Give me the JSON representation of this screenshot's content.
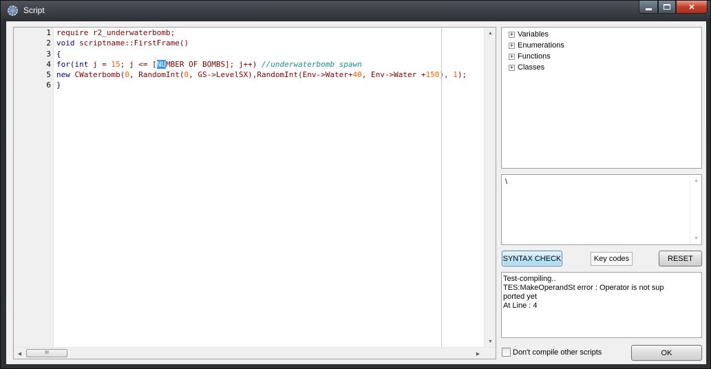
{
  "window": {
    "title": "Script"
  },
  "editor": {
    "line_numbers": [
      "1",
      "2",
      "3",
      "4",
      "5",
      "6"
    ],
    "lines": [
      [
        {
          "t": "require r2_underwaterbomb;",
          "c": "tx"
        }
      ],
      [
        {
          "t": "void ",
          "c": "kw"
        },
        {
          "t": "scriptname::FirstFrame()",
          "c": "tx"
        }
      ],
      [
        {
          "t": "{",
          "c": "kw"
        }
      ],
      [
        {
          "t": "for(int",
          "c": "kw"
        },
        {
          "t": " j = ",
          "c": "tx"
        },
        {
          "t": "15",
          "c": "num"
        },
        {
          "t": "; j <= [",
          "c": "tx"
        },
        {
          "t": "NU",
          "c": "sel"
        },
        {
          "t": "MBER OF BOMBS]; j++) ",
          "c": "tx"
        },
        {
          "t": "//underwaterbomb spawn",
          "c": "cm"
        }
      ],
      [
        {
          "t": "new",
          "c": "kw"
        },
        {
          "t": " CWaterbomb(",
          "c": "tx"
        },
        {
          "t": "0",
          "c": "num"
        },
        {
          "t": ", RandomInt(",
          "c": "tx"
        },
        {
          "t": "0",
          "c": "num"
        },
        {
          "t": ", GS->LevelSX),RandomInt(Env->Water+",
          "c": "tx"
        },
        {
          "t": "40",
          "c": "num"
        },
        {
          "t": ", Env->Water +",
          "c": "tx"
        },
        {
          "t": "150",
          "c": "num"
        },
        {
          "t": "), ",
          "c": "tx"
        },
        {
          "t": "1",
          "c": "num"
        },
        {
          "t": ");",
          "c": "tx"
        }
      ],
      [
        {
          "t": "}",
          "c": "kw"
        }
      ]
    ],
    "hscroll_thumb": "III"
  },
  "tree": {
    "items": [
      {
        "label": "Variables",
        "expander": "+"
      },
      {
        "label": "Enumerations",
        "expander": "+"
      },
      {
        "label": "Functions",
        "expander": "+"
      },
      {
        "label": "Classes",
        "expander": "+"
      }
    ]
  },
  "description": {
    "text": "\\"
  },
  "buttons": {
    "syntax_check": "SYNTAX CHECK",
    "key_codes": "Key codes",
    "reset": "RESET",
    "ok": "OK"
  },
  "output": {
    "lines": [
      "Test-compiling..",
      "TES:MakeOperandSt error : Operator is not sup",
      "ported yet",
      "At Line : 4"
    ]
  },
  "options": {
    "dont_compile_label": "Don't compile other scripts",
    "dont_compile_checked": false
  }
}
